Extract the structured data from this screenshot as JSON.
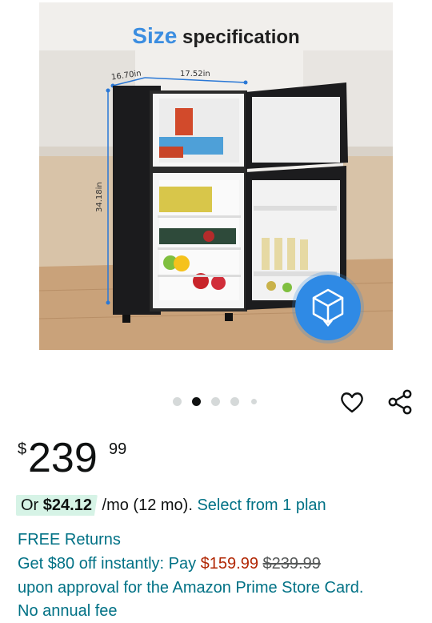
{
  "image": {
    "title_accent": "Size",
    "title_rest": "specification",
    "dims": {
      "depth": "16.70in",
      "width": "17.52in",
      "height": "34.18in"
    },
    "ar_icon": "3d-cube-icon"
  },
  "carousel": {
    "total": 5,
    "active_index": 1
  },
  "actions": {
    "favorite_icon": "heart-icon",
    "share_icon": "share-icon"
  },
  "price": {
    "symbol": "$",
    "whole": "239",
    "fraction": "99"
  },
  "financing": {
    "prefix": "Or",
    "amount": "$24.12",
    "term": "/mo (12 mo).",
    "link": "Select from 1 plan"
  },
  "returns": "FREE Returns",
  "promo": {
    "text_start": "Get $80 off instantly: Pay",
    "sale_price": "$159.99",
    "original_price": "$239.99",
    "text_end": "upon approval for the Amazon Prime Store Card.",
    "cutoff_text": "No annual fee"
  },
  "colors": {
    "accent_link": "#007185",
    "sale_red": "#b12704",
    "pill_green": "#d6f3e6"
  }
}
